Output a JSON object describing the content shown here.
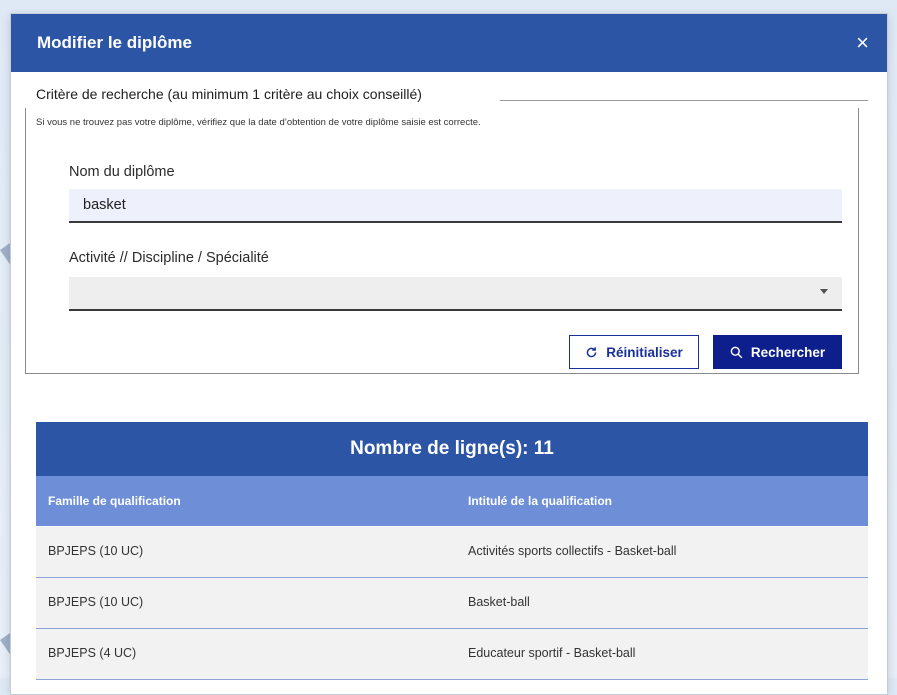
{
  "dialog": {
    "title": "Modifier le diplôme",
    "close_glyph": "×"
  },
  "search": {
    "legend": "Critère de recherche (au minimum 1 critère au choix conseillé)",
    "hint": "Si vous ne trouvez pas votre diplôme, vérifiez que la date d’obtention de votre diplôme saisie est correcte.",
    "name_label": "Nom du diplôme",
    "name_value": "basket",
    "activity_label": "Activité // Discipline / Spécialité",
    "activity_value": "",
    "reset_label": "Réinitialiser",
    "search_label": "Rechercher"
  },
  "results": {
    "count_text": "Nombre de ligne(s): 11",
    "columns": [
      "Famille de qualification",
      "Intitulé de la qualification"
    ],
    "rows": [
      {
        "famille": "BPJEPS (10 UC)",
        "intitule": "Activités sports collectifs - Basket-ball"
      },
      {
        "famille": "BPJEPS (10 UC)",
        "intitule": "Basket-ball"
      },
      {
        "famille": "BPJEPS (4 UC)",
        "intitule": "Educateur sportif - Basket-ball"
      }
    ]
  },
  "colors": {
    "header_blue": "#2c55a6",
    "table_head_blue": "#6e8fd8",
    "primary_button": "#0d1f8c"
  },
  "icons": {
    "reset": "refresh-icon",
    "search": "search-icon",
    "select": "chevron-down-icon",
    "close": "close-icon"
  }
}
